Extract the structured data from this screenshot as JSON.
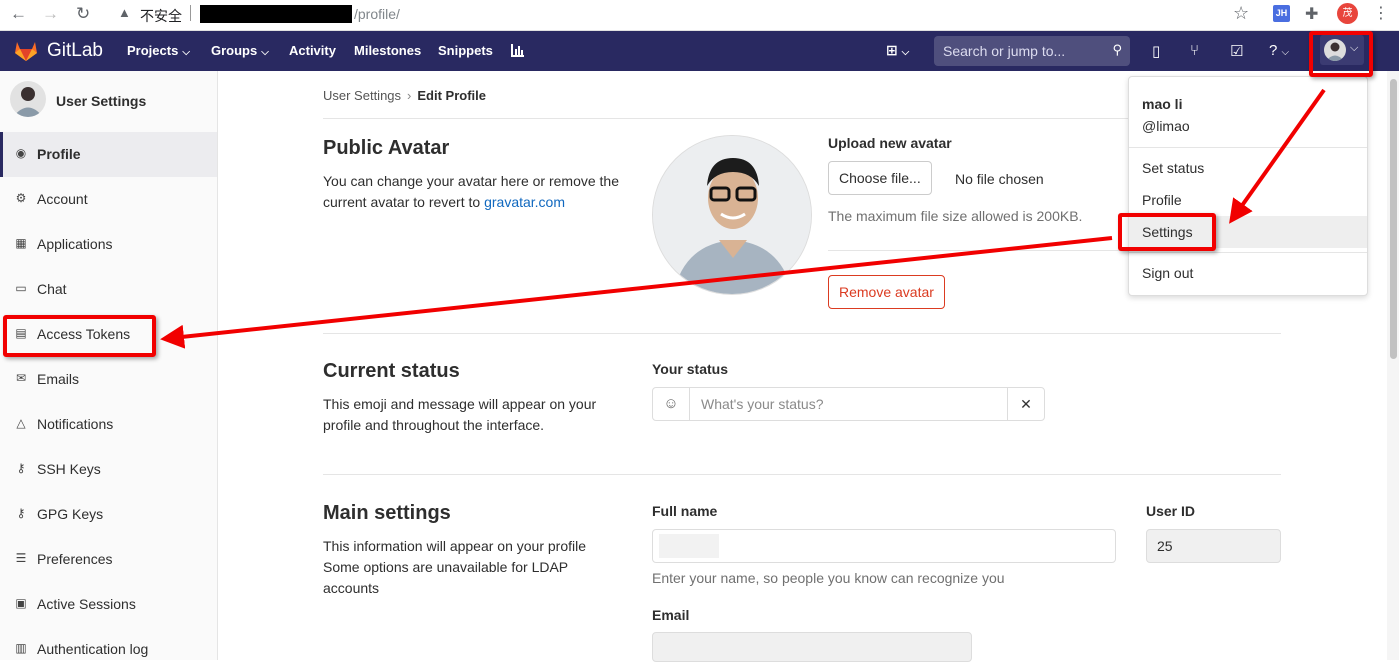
{
  "browser": {
    "insecure_label": "不安全",
    "url_path": "/profile/",
    "ext_badge": "JH",
    "profile_initial": "茂"
  },
  "nav": {
    "brand": "GitLab",
    "links": [
      "Projects",
      "Groups",
      "Activity",
      "Milestones",
      "Snippets"
    ],
    "search_placeholder": "Search or jump to..."
  },
  "sidebar": {
    "title": "User Settings",
    "items": [
      {
        "label": "Profile",
        "icon": "profile-icon"
      },
      {
        "label": "Account",
        "icon": "account-icon"
      },
      {
        "label": "Applications",
        "icon": "applications-icon"
      },
      {
        "label": "Chat",
        "icon": "chat-icon"
      },
      {
        "label": "Access Tokens",
        "icon": "token-icon"
      },
      {
        "label": "Emails",
        "icon": "mail-icon"
      },
      {
        "label": "Notifications",
        "icon": "bell-icon"
      },
      {
        "label": "SSH Keys",
        "icon": "key-icon"
      },
      {
        "label": "GPG Keys",
        "icon": "key-icon"
      },
      {
        "label": "Preferences",
        "icon": "sliders-icon"
      },
      {
        "label": "Active Sessions",
        "icon": "monitor-icon"
      },
      {
        "label": "Authentication log",
        "icon": "log-icon"
      }
    ]
  },
  "breadcrumb": {
    "parent": "User Settings",
    "current": "Edit Profile"
  },
  "avatar_section": {
    "title": "Public Avatar",
    "desc_text": "You can change your avatar here or remove the current avatar to revert to",
    "desc_link": "gravatar.com",
    "upload_label": "Upload new avatar",
    "choose_button": "Choose file...",
    "no_file": "No file chosen",
    "max_size": "The maximum file size allowed is 200KB.",
    "remove_button": "Remove avatar"
  },
  "status_section": {
    "title": "Current status",
    "desc": "This emoji and message will appear on your profile and throughout the interface.",
    "label": "Your status",
    "placeholder": "What's your status?",
    "clear": "✕"
  },
  "main_section": {
    "title": "Main settings",
    "desc": "This information will appear on your profile Some options are unavailable for LDAP accounts",
    "full_name_label": "Full name",
    "full_name_help": "Enter your name, so people you know can recognize you",
    "user_id_label": "User ID",
    "user_id_value": "25",
    "email_label": "Email"
  },
  "dropdown": {
    "name": "mao li",
    "handle": "@limao",
    "items": [
      "Set status",
      "Profile",
      "Settings",
      "Sign out"
    ]
  },
  "colors": {
    "navbar": "#292961",
    "annotation": "#f10000",
    "link": "#1068bf",
    "danger": "#db3b21"
  }
}
